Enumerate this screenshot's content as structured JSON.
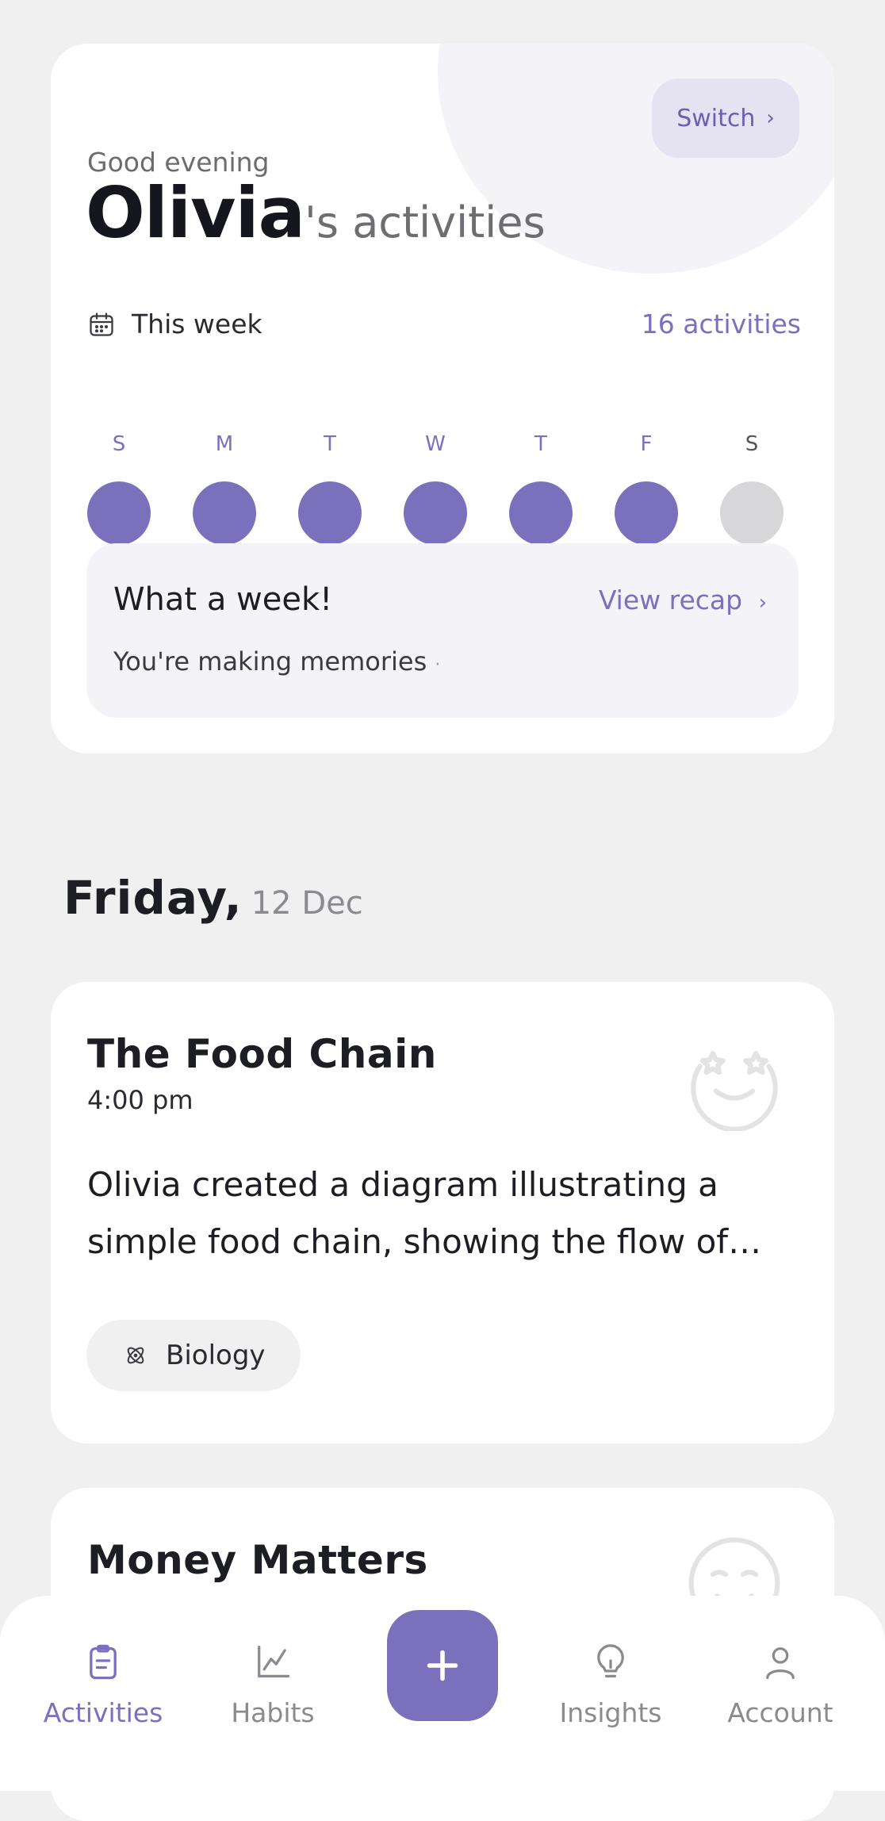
{
  "header": {
    "greeting": "Good evening",
    "switch_label": "Switch",
    "child_name": "Olivia",
    "title_suffix": "'s activities",
    "week_label": "This week",
    "activity_count": "16 activities",
    "days": [
      {
        "letter": "S",
        "done": true
      },
      {
        "letter": "M",
        "done": true
      },
      {
        "letter": "T",
        "done": true
      },
      {
        "letter": "W",
        "done": true
      },
      {
        "letter": "T",
        "done": true
      },
      {
        "letter": "F",
        "done": true
      },
      {
        "letter": "S",
        "done": false
      }
    ],
    "recap": {
      "title": "What a week!",
      "link_label": "View recap",
      "subtitle": "You're making memories"
    }
  },
  "date_heading": {
    "day": "Friday,",
    "date": "12 Dec"
  },
  "activities": [
    {
      "title": "The Food Chain",
      "time": "4:00 pm",
      "description": "Olivia created a diagram illustrating a simple food chain, showing the flow of energy",
      "tag": "Biology",
      "mood_icon": "star-eyes-face-icon"
    },
    {
      "title": "Money Matters",
      "mood_icon": "smile-face-icon"
    }
  ],
  "nav": {
    "items": [
      {
        "label": "Activities",
        "icon": "clipboard-icon",
        "active": true
      },
      {
        "label": "Habits",
        "icon": "chart-line-icon",
        "active": false
      },
      {
        "label": "Insights",
        "icon": "lightbulb-icon",
        "active": false
      },
      {
        "label": "Account",
        "icon": "user-icon",
        "active": false
      }
    ],
    "add_icon": "plus-icon"
  },
  "colors": {
    "accent": "#7a70bc",
    "accent_text": "#7b70bf",
    "background": "#f0f0f0",
    "inactive_day": "#d7d7d9"
  }
}
